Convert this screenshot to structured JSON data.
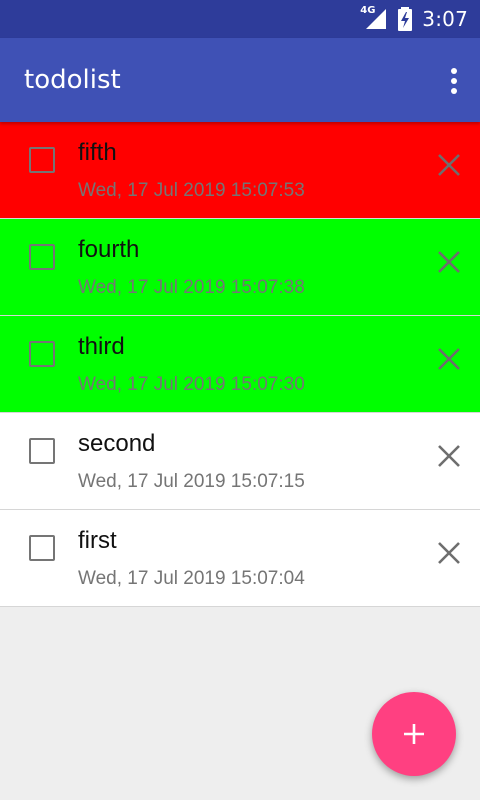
{
  "status_bar": {
    "network_type": "4G",
    "time": "3:07"
  },
  "app_bar": {
    "title": "todolist",
    "overflow_icon": "more-vert-icon"
  },
  "todos": [
    {
      "title": "fifth",
      "timestamp": "Wed, 17 Jul 2019 15:07:53",
      "color": "#ff0000",
      "checked": false
    },
    {
      "title": "fourth",
      "timestamp": "Wed, 17 Jul 2019 15:07:38",
      "color": "#00ff00",
      "checked": false
    },
    {
      "title": "third",
      "timestamp": "Wed, 17 Jul 2019 15:07:30",
      "color": "#00ff00",
      "checked": false
    },
    {
      "title": "second",
      "timestamp": "Wed, 17 Jul 2019 15:07:15",
      "color": "#ffffff",
      "checked": false
    },
    {
      "title": "first",
      "timestamp": "Wed, 17 Jul 2019 15:07:04",
      "color": "#ffffff",
      "checked": false
    }
  ],
  "fab": {
    "icon": "add-icon",
    "color": "#ff4081"
  },
  "theme": {
    "primary": "#3f51b5",
    "primary_dark": "#2e3c9a"
  }
}
